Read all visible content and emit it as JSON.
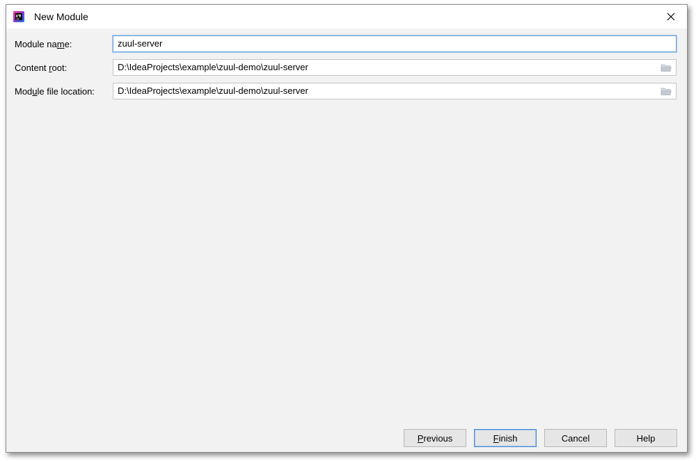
{
  "window": {
    "title": "New Module",
    "close_glyph": "✕"
  },
  "form": {
    "module_name": {
      "label_pre": "Module na",
      "label_mn": "m",
      "label_post": "e:",
      "value": "zuul-server"
    },
    "content_root": {
      "label_pre": "Content ",
      "label_mn": "r",
      "label_post": "oot:",
      "value": "D:\\IdeaProjects\\example\\zuul-demo\\zuul-server"
    },
    "module_file_location": {
      "label_pre": "Mod",
      "label_mn": "u",
      "label_post": "le file location:",
      "value": "D:\\IdeaProjects\\example\\zuul-demo\\zuul-server"
    }
  },
  "buttons": {
    "previous": {
      "mn": "P",
      "rest": "revious"
    },
    "finish": {
      "mn": "F",
      "rest": "inish"
    },
    "cancel": {
      "label": "Cancel"
    },
    "help": {
      "label": "Help"
    }
  },
  "icons": {
    "app": "intellij-idea-icon",
    "browse": "folder-icon",
    "close": "close-icon"
  },
  "colors": {
    "dialog_bg": "#f2f2f2",
    "focus_border": "#6da5dd",
    "default_button_border": "#4a8ad6"
  }
}
